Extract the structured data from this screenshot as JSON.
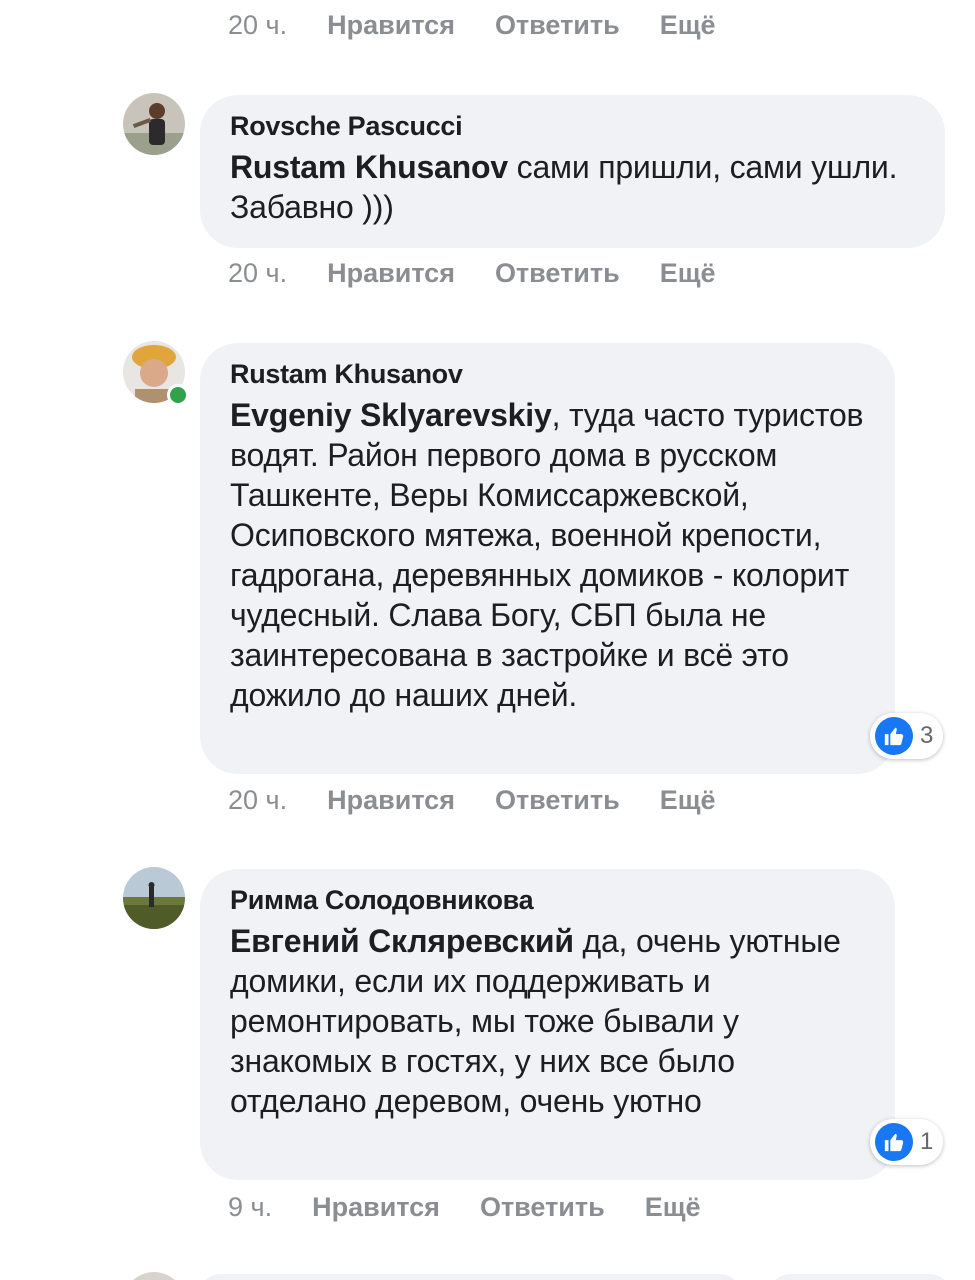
{
  "actions_labels": {
    "like": "Нравится",
    "reply": "Ответить",
    "more": "Ещё"
  },
  "top_partial": {
    "time": "20 ч."
  },
  "comments": [
    {
      "author": "Rovsche Pascucci",
      "mention": "Rustam Khusanov",
      "text": " сами пришли, сами ушли. Забавно )))",
      "time": "20 ч."
    },
    {
      "author": "Rustam Khusanov",
      "mention": "Evgeniy Sklyarevskiy",
      "text": ", туда часто туристов водят. Район первого дома в русском Ташкенте, Веры Комиссаржевской, Осиповского мятежа, военной крепости, гадрогана, деревянных домиков - колорит чудесный. Слава Богу, СБП была не заинтересована в застройке и всё это дожило до наших дней.",
      "time": "20 ч.",
      "reactions": "3",
      "online": true
    },
    {
      "author": "Римма Солодовникова",
      "mention": "Евгений Скляревский",
      "text": " да, очень уютные домики, если их поддерживать и ремонтировать, мы тоже бывали у знакомых в гостях, у них все было отделано деревом, очень уютно",
      "time": "9 ч.",
      "reactions": "1"
    }
  ],
  "colors": {
    "bubble": "#f0f2f5",
    "meta": "#8a8d91",
    "like_blue": "#1877f2",
    "online_green": "#31a24c"
  },
  "icons": {
    "reaction": "like-thumb-icon"
  }
}
